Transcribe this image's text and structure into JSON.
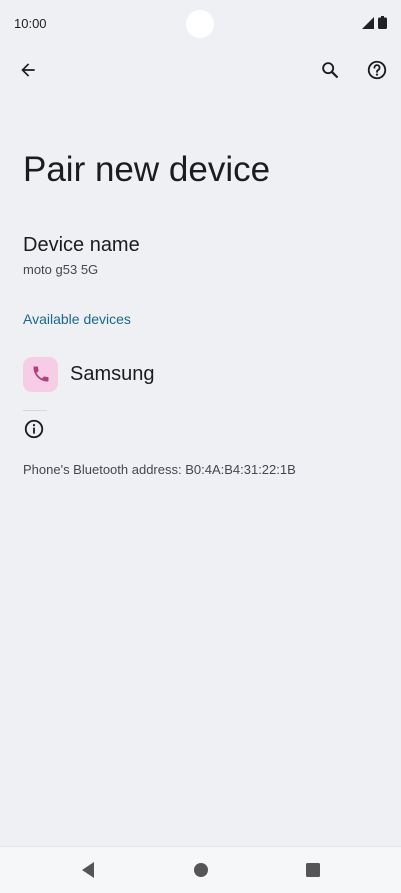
{
  "status_bar": {
    "time": "10:00"
  },
  "page": {
    "title": "Pair new device"
  },
  "device_name": {
    "title": "Device name",
    "value": "moto g53 5G"
  },
  "available_devices": {
    "header": "Available devices",
    "items": [
      {
        "label": "Samsung",
        "icon": "phone-icon"
      }
    ]
  },
  "footer": {
    "address": "Phone's Bluetooth address: B0:4A:B4:31:22:1B"
  },
  "colors": {
    "background": "#eff0f3",
    "accent": "#19678f",
    "device_icon_bg": "#f6cde4",
    "device_icon_fg": "#b0417e"
  }
}
